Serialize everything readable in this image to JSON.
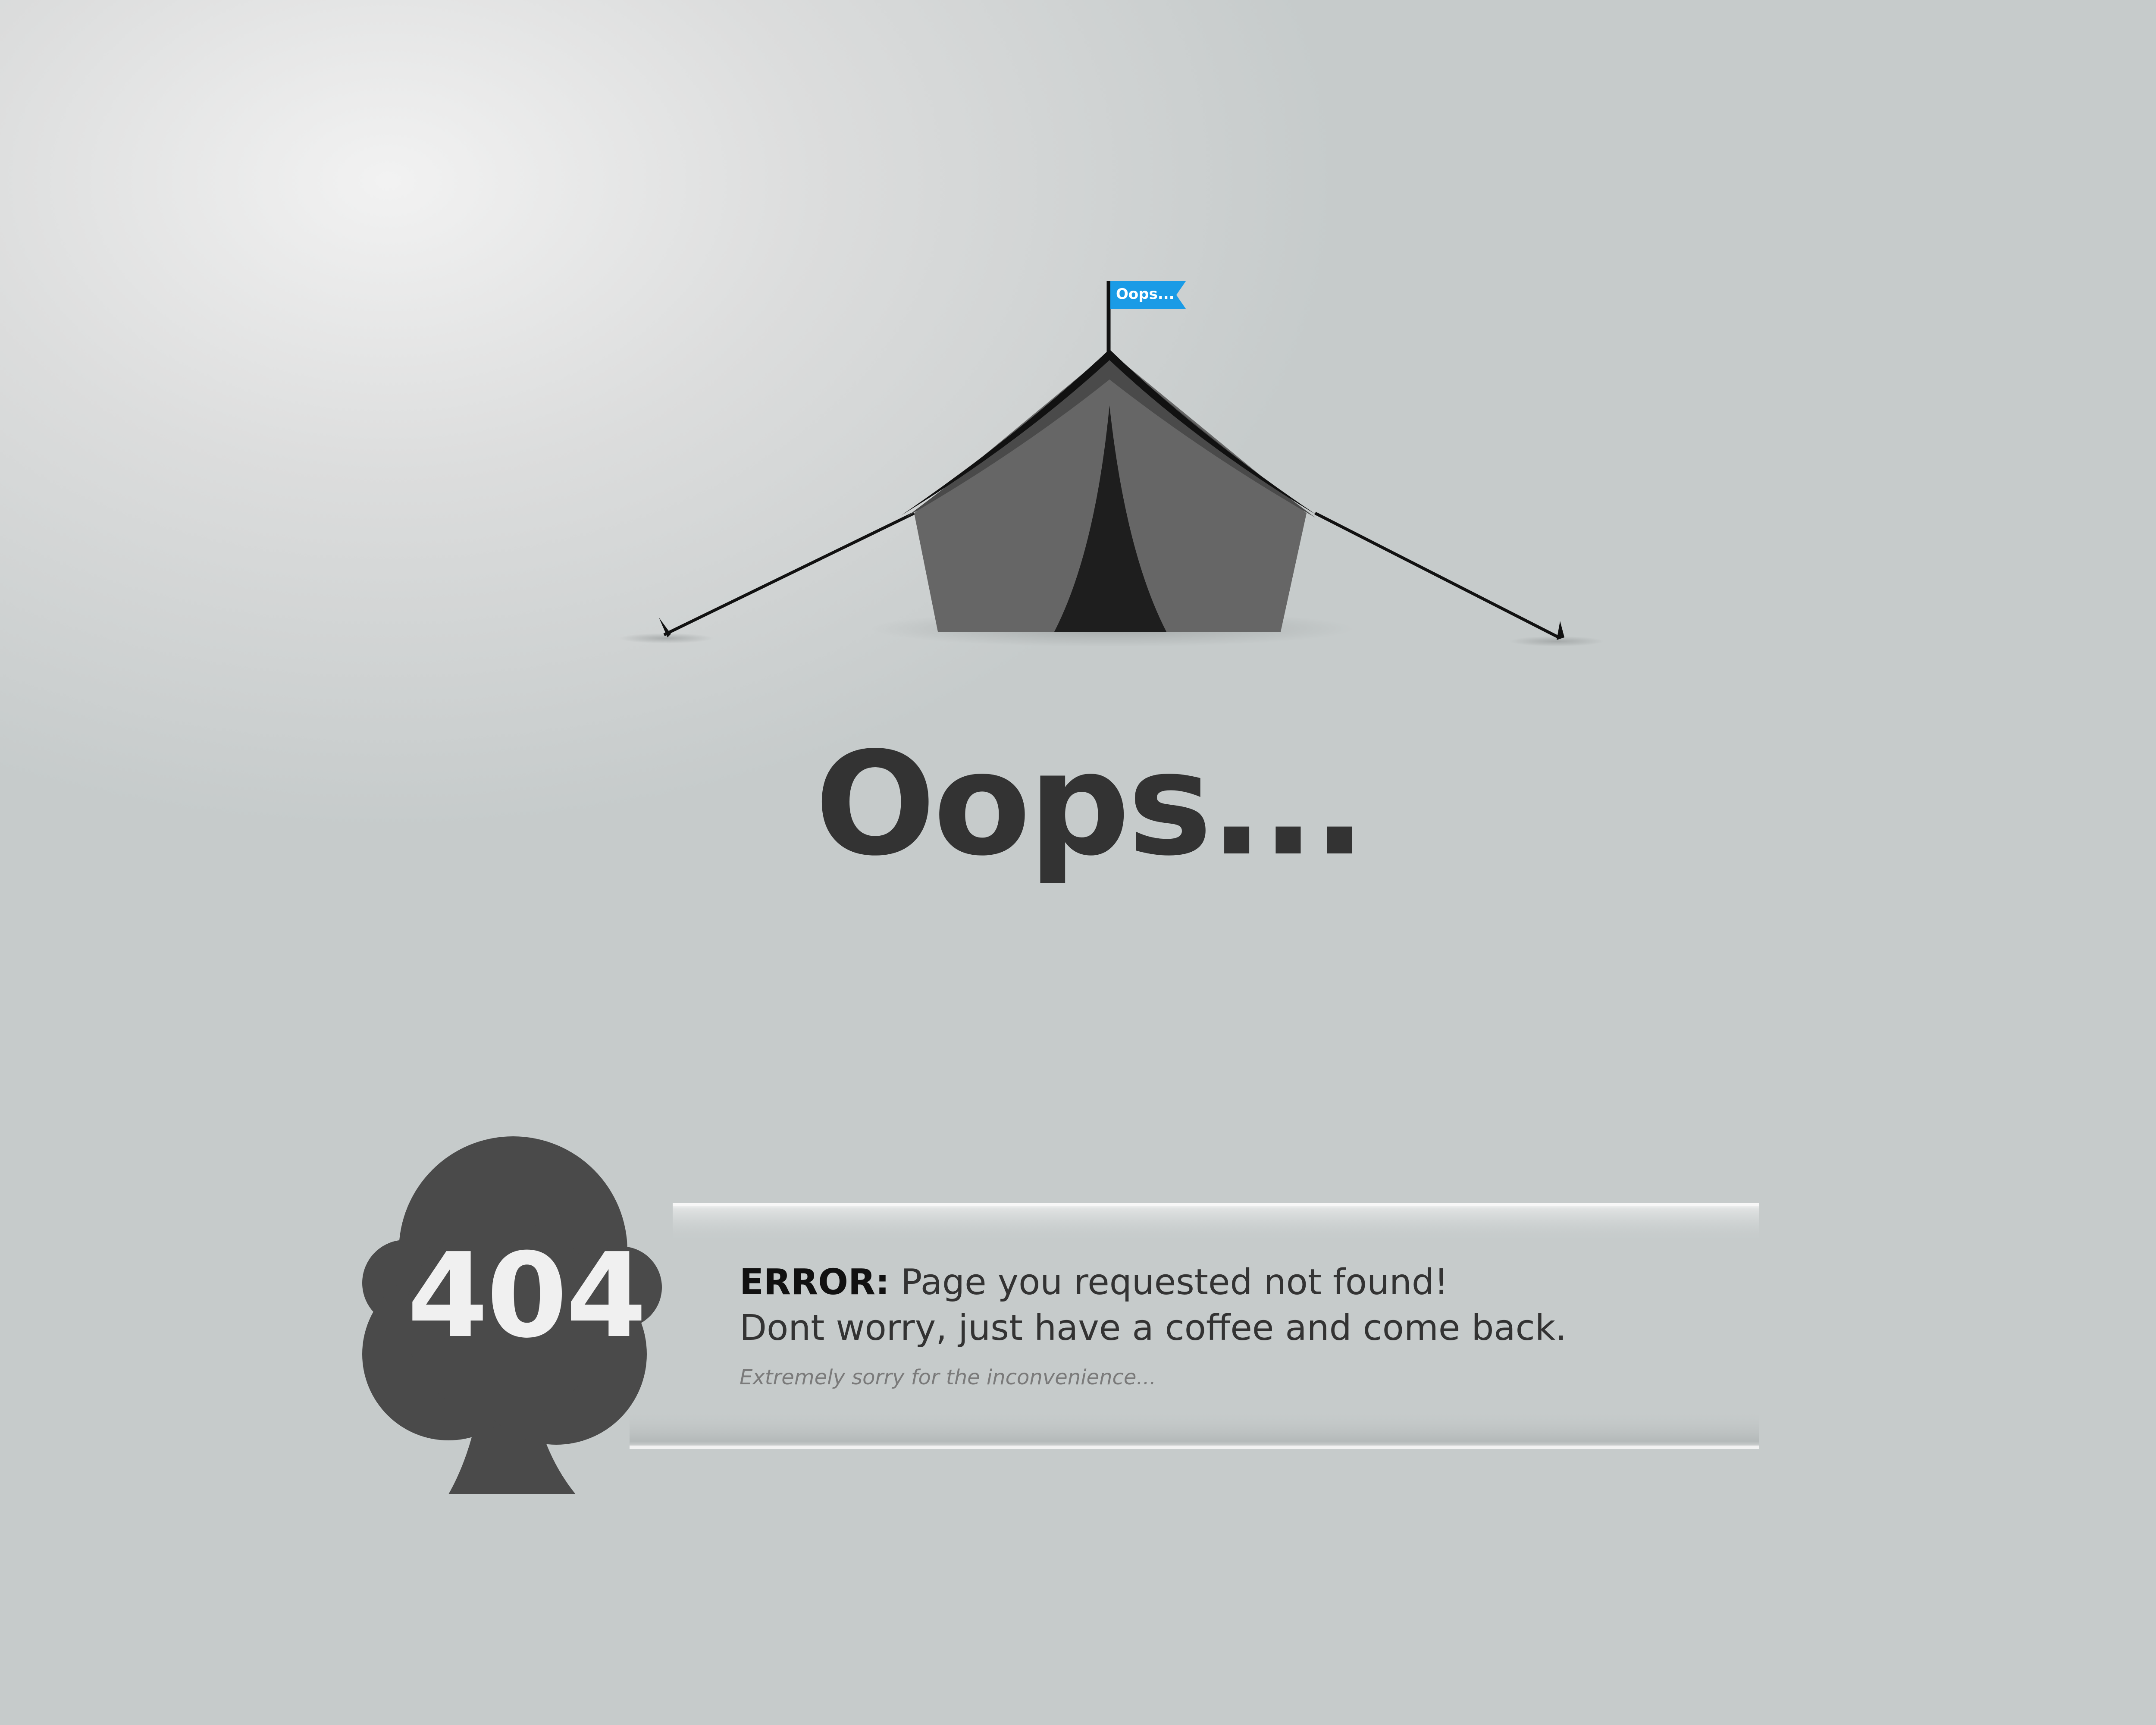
{
  "scene": {
    "flag_label": "Oops...",
    "headline": "Oops...",
    "error_code": "404"
  },
  "message": {
    "error_label": "ERROR:",
    "error_text": " Page you requested not found!",
    "line2": "Dont worry, just have a coffee and come back.",
    "line3": "Extremely sorry for the inconvenience..."
  },
  "colors": {
    "background_light": "#f2f2f2",
    "background_dark": "#c6cbcb",
    "tent": "#666666",
    "tent_door": "#1e1e1e",
    "flag": "#1a9be6",
    "tree": "#4a4a4a",
    "text": "#333333"
  },
  "icons": [
    "tent-icon",
    "flag-icon",
    "tree-icon"
  ]
}
